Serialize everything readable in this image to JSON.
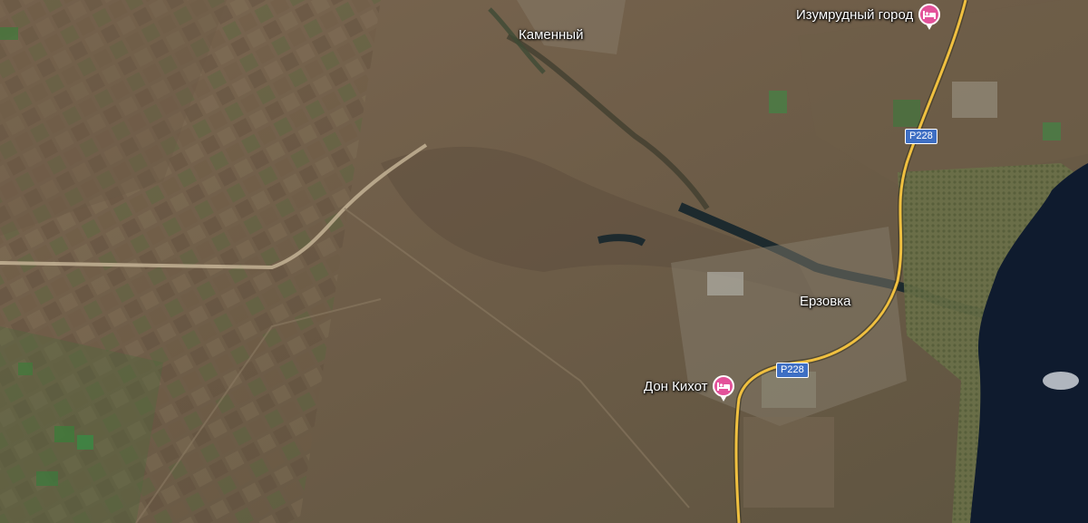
{
  "map": {
    "places": {
      "kamenny": "Каменный",
      "erzovka": "Ерзовка"
    },
    "pois": {
      "izumrudny": "Изумрудный город",
      "don_kikhot": "Дон Кихот"
    },
    "roads": {
      "shield_upper": "Р228",
      "shield_lower": "Р228"
    },
    "icons": {
      "hotel": "bed-icon"
    },
    "colors": {
      "hotel_pin": "#e3529a",
      "road": "#f0c040",
      "road_shield": "#3e6fc4",
      "water": "#0f1b2e"
    }
  }
}
